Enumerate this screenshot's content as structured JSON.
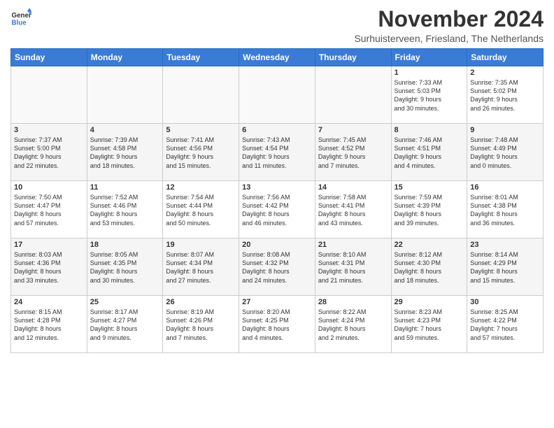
{
  "header": {
    "logo_general": "General",
    "logo_blue": "Blue",
    "title": "November 2024",
    "subtitle": "Surhuisterveen, Friesland, The Netherlands"
  },
  "weekdays": [
    "Sunday",
    "Monday",
    "Tuesday",
    "Wednesday",
    "Thursday",
    "Friday",
    "Saturday"
  ],
  "weeks": [
    [
      {
        "day": "",
        "info": ""
      },
      {
        "day": "",
        "info": ""
      },
      {
        "day": "",
        "info": ""
      },
      {
        "day": "",
        "info": ""
      },
      {
        "day": "",
        "info": ""
      },
      {
        "day": "1",
        "info": "Sunrise: 7:33 AM\nSunset: 5:03 PM\nDaylight: 9 hours\nand 30 minutes."
      },
      {
        "day": "2",
        "info": "Sunrise: 7:35 AM\nSunset: 5:02 PM\nDaylight: 9 hours\nand 26 minutes."
      }
    ],
    [
      {
        "day": "3",
        "info": "Sunrise: 7:37 AM\nSunset: 5:00 PM\nDaylight: 9 hours\nand 22 minutes."
      },
      {
        "day": "4",
        "info": "Sunrise: 7:39 AM\nSunset: 4:58 PM\nDaylight: 9 hours\nand 18 minutes."
      },
      {
        "day": "5",
        "info": "Sunrise: 7:41 AM\nSunset: 4:56 PM\nDaylight: 9 hours\nand 15 minutes."
      },
      {
        "day": "6",
        "info": "Sunrise: 7:43 AM\nSunset: 4:54 PM\nDaylight: 9 hours\nand 11 minutes."
      },
      {
        "day": "7",
        "info": "Sunrise: 7:45 AM\nSunset: 4:52 PM\nDaylight: 9 hours\nand 7 minutes."
      },
      {
        "day": "8",
        "info": "Sunrise: 7:46 AM\nSunset: 4:51 PM\nDaylight: 9 hours\nand 4 minutes."
      },
      {
        "day": "9",
        "info": "Sunrise: 7:48 AM\nSunset: 4:49 PM\nDaylight: 9 hours\nand 0 minutes."
      }
    ],
    [
      {
        "day": "10",
        "info": "Sunrise: 7:50 AM\nSunset: 4:47 PM\nDaylight: 8 hours\nand 57 minutes."
      },
      {
        "day": "11",
        "info": "Sunrise: 7:52 AM\nSunset: 4:46 PM\nDaylight: 8 hours\nand 53 minutes."
      },
      {
        "day": "12",
        "info": "Sunrise: 7:54 AM\nSunset: 4:44 PM\nDaylight: 8 hours\nand 50 minutes."
      },
      {
        "day": "13",
        "info": "Sunrise: 7:56 AM\nSunset: 4:42 PM\nDaylight: 8 hours\nand 46 minutes."
      },
      {
        "day": "14",
        "info": "Sunrise: 7:58 AM\nSunset: 4:41 PM\nDaylight: 8 hours\nand 43 minutes."
      },
      {
        "day": "15",
        "info": "Sunrise: 7:59 AM\nSunset: 4:39 PM\nDaylight: 8 hours\nand 39 minutes."
      },
      {
        "day": "16",
        "info": "Sunrise: 8:01 AM\nSunset: 4:38 PM\nDaylight: 8 hours\nand 36 minutes."
      }
    ],
    [
      {
        "day": "17",
        "info": "Sunrise: 8:03 AM\nSunset: 4:36 PM\nDaylight: 8 hours\nand 33 minutes."
      },
      {
        "day": "18",
        "info": "Sunrise: 8:05 AM\nSunset: 4:35 PM\nDaylight: 8 hours\nand 30 minutes."
      },
      {
        "day": "19",
        "info": "Sunrise: 8:07 AM\nSunset: 4:34 PM\nDaylight: 8 hours\nand 27 minutes."
      },
      {
        "day": "20",
        "info": "Sunrise: 8:08 AM\nSunset: 4:32 PM\nDaylight: 8 hours\nand 24 minutes."
      },
      {
        "day": "21",
        "info": "Sunrise: 8:10 AM\nSunset: 4:31 PM\nDaylight: 8 hours\nand 21 minutes."
      },
      {
        "day": "22",
        "info": "Sunrise: 8:12 AM\nSunset: 4:30 PM\nDaylight: 8 hours\nand 18 minutes."
      },
      {
        "day": "23",
        "info": "Sunrise: 8:14 AM\nSunset: 4:29 PM\nDaylight: 8 hours\nand 15 minutes."
      }
    ],
    [
      {
        "day": "24",
        "info": "Sunrise: 8:15 AM\nSunset: 4:28 PM\nDaylight: 8 hours\nand 12 minutes."
      },
      {
        "day": "25",
        "info": "Sunrise: 8:17 AM\nSunset: 4:27 PM\nDaylight: 8 hours\nand 9 minutes."
      },
      {
        "day": "26",
        "info": "Sunrise: 8:19 AM\nSunset: 4:26 PM\nDaylight: 8 hours\nand 7 minutes."
      },
      {
        "day": "27",
        "info": "Sunrise: 8:20 AM\nSunset: 4:25 PM\nDaylight: 8 hours\nand 4 minutes."
      },
      {
        "day": "28",
        "info": "Sunrise: 8:22 AM\nSunset: 4:24 PM\nDaylight: 8 hours\nand 2 minutes."
      },
      {
        "day": "29",
        "info": "Sunrise: 8:23 AM\nSunset: 4:23 PM\nDaylight: 7 hours\nand 59 minutes."
      },
      {
        "day": "30",
        "info": "Sunrise: 8:25 AM\nSunset: 4:22 PM\nDaylight: 7 hours\nand 57 minutes."
      }
    ]
  ]
}
